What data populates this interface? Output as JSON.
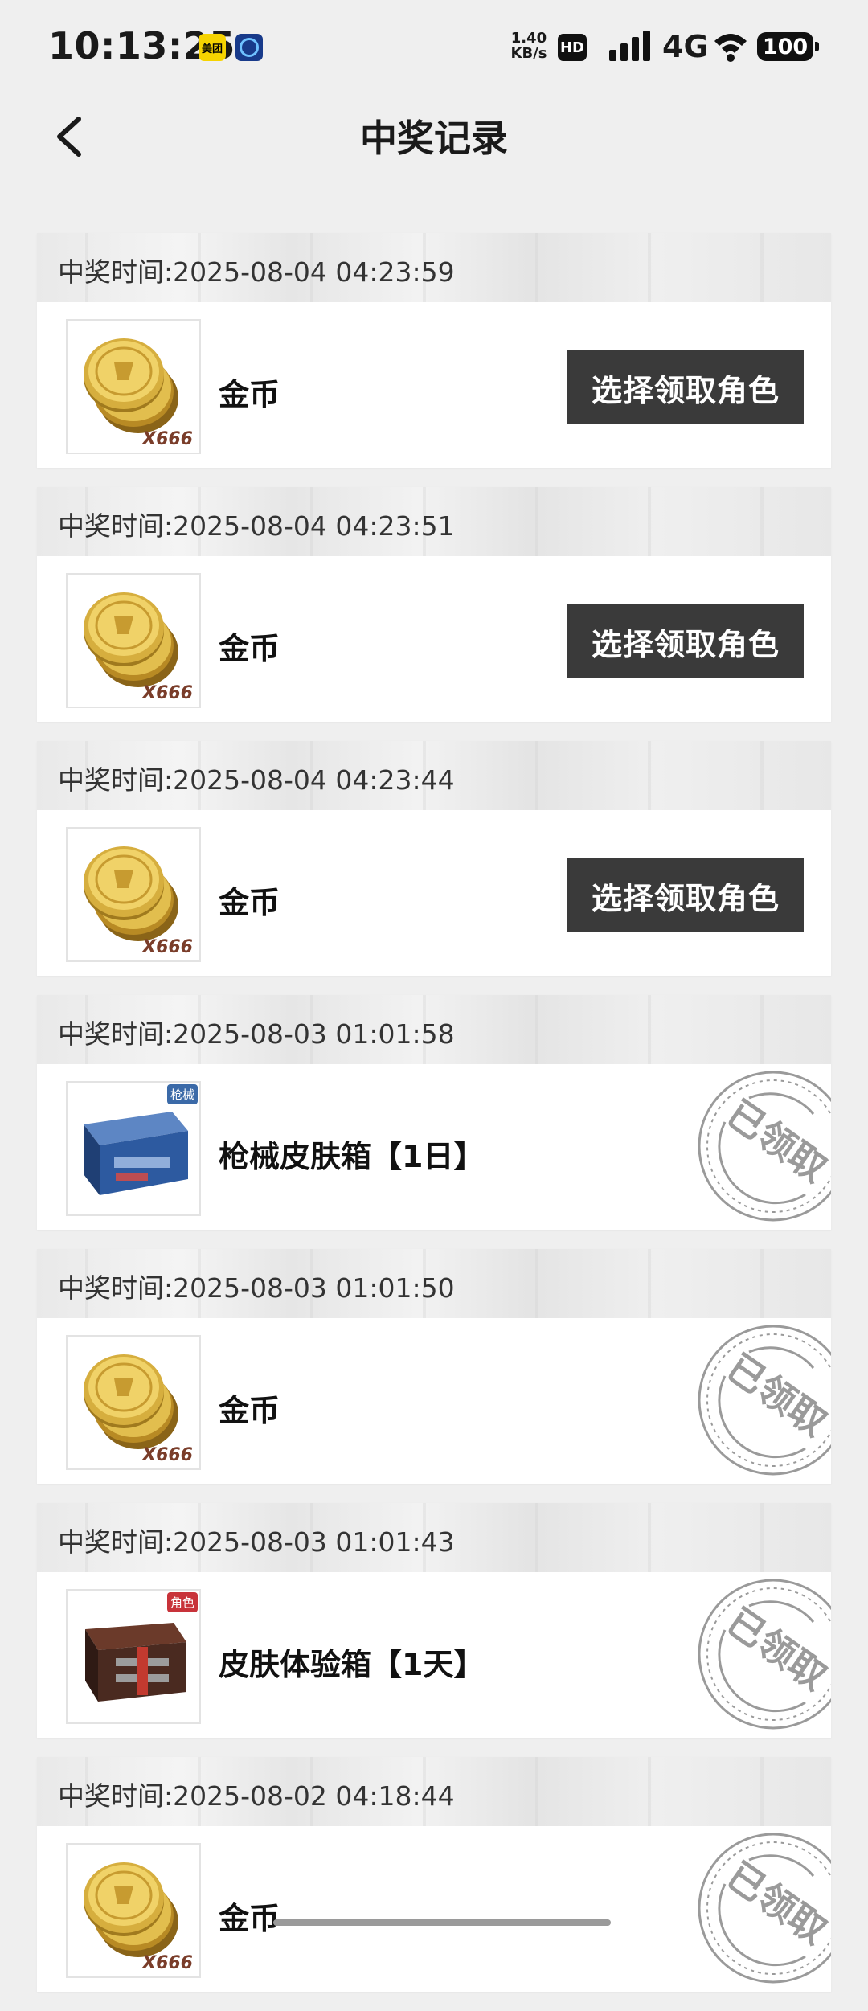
{
  "status_bar": {
    "time": "10:13:25",
    "badge_meituan": "美团",
    "net_speed_value": "1.40",
    "net_speed_unit": "KB/s",
    "hd": "HD",
    "network": "4G",
    "battery": "100"
  },
  "header": {
    "title": "中奖记录",
    "back_icon": "chevron-left-icon"
  },
  "records": [
    {
      "time_label": "中奖时间:2025-08-04 04:23:59",
      "prize": "金币",
      "qty": "X666",
      "icon": "gold-coins",
      "status": "unclaimed",
      "button_label": "选择领取角色"
    },
    {
      "time_label": "中奖时间:2025-08-04 04:23:51",
      "prize": "金币",
      "qty": "X666",
      "icon": "gold-coins",
      "status": "unclaimed",
      "button_label": "选择领取角色"
    },
    {
      "time_label": "中奖时间:2025-08-04 04:23:44",
      "prize": "金币",
      "qty": "X666",
      "icon": "gold-coins",
      "status": "unclaimed",
      "button_label": "选择领取角色"
    },
    {
      "time_label": "中奖时间:2025-08-03 01:01:58",
      "prize": "枪械皮肤箱【1日】",
      "tag": "枪械",
      "icon": "weapon-skin-box",
      "status": "claimed",
      "stamp": "已领取"
    },
    {
      "time_label": "中奖时间:2025-08-03 01:01:50",
      "prize": "金币",
      "qty": "X666",
      "icon": "gold-coins",
      "status": "claimed",
      "stamp": "已领取"
    },
    {
      "time_label": "中奖时间:2025-08-03 01:01:43",
      "prize": "皮肤体验箱【1天】",
      "tag": "角色",
      "icon": "skin-trial-box",
      "status": "claimed",
      "stamp": "已领取"
    },
    {
      "time_label": "中奖时间:2025-08-02 04:18:44",
      "prize": "金币",
      "qty": "X666",
      "icon": "gold-coins",
      "status": "claimed",
      "stamp": "已领取"
    }
  ],
  "colors": {
    "button_bg": "#3a3a3a",
    "stamp": "#9a9a9a",
    "page_bg": "#efefef"
  }
}
